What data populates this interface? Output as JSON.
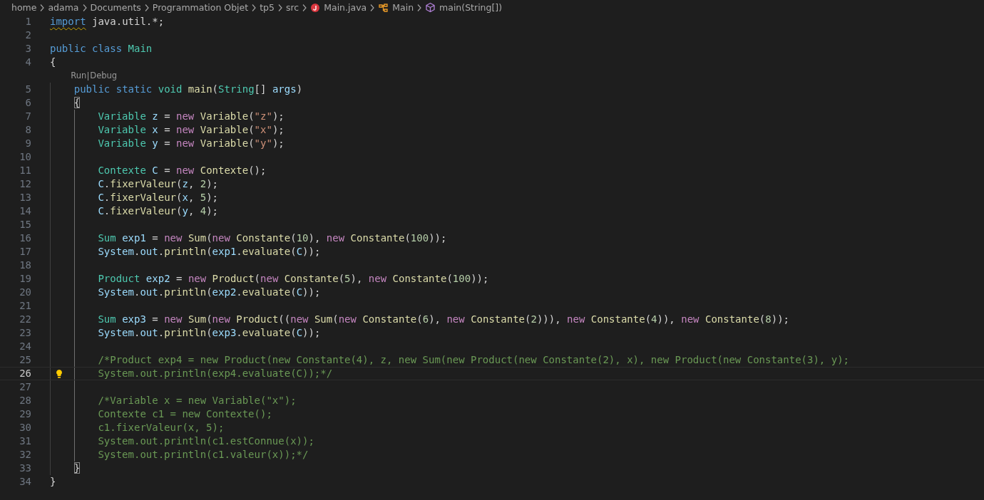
{
  "breadcrumb": [
    {
      "label": "home",
      "kind": "folder"
    },
    {
      "label": "adama",
      "kind": "folder"
    },
    {
      "label": "Documents",
      "kind": "folder"
    },
    {
      "label": "Programmation Objet",
      "kind": "folder"
    },
    {
      "label": "tp5",
      "kind": "folder"
    },
    {
      "label": "src",
      "kind": "folder"
    },
    {
      "label": "Main.java",
      "kind": "java-file"
    },
    {
      "label": "Main",
      "kind": "class"
    },
    {
      "label": "main(String[])",
      "kind": "method"
    }
  ],
  "editor": {
    "lines": [
      {
        "number": "1",
        "tokens": [
          {
            "kind": "kw",
            "text": "import",
            "warning": true
          },
          {
            "kind": "pl",
            "text": " java.util.*;"
          }
        ]
      },
      {
        "number": "2"
      },
      {
        "number": "3",
        "tokens": [
          {
            "kind": "kw",
            "text": "public class"
          },
          {
            "kind": "type",
            "text": " Main"
          }
        ]
      },
      {
        "number": "4",
        "tokens": [
          {
            "kind": "pl",
            "text": "{"
          }
        ],
        "children": [
          {
            "number": "5",
            "codelens": [
              "Run",
              "Debug"
            ],
            "tokens": [
              {
                "kind": "kw",
                "text": "public static"
              },
              {
                "kind": "type",
                "text": " void"
              },
              {
                "kind": "fn",
                "text": " main"
              },
              {
                "kind": "pl",
                "text": "("
              },
              {
                "kind": "type",
                "text": "String"
              },
              {
                "kind": "pl",
                "text": "[] "
              },
              {
                "kind": "var",
                "text": "args"
              },
              {
                "kind": "pl",
                "text": ")"
              }
            ]
          },
          {
            "number": "6",
            "tokens": [
              {
                "kind": "pl",
                "text": "{",
                "matched": true
              }
            ],
            "children": [
              {
                "number": "7",
                "tokens": [
                  {
                    "kind": "type",
                    "text": "Variable"
                  },
                  {
                    "kind": "var",
                    "text": " z"
                  },
                  {
                    "kind": "pl",
                    "text": " = "
                  },
                  {
                    "kind": "ctl",
                    "text": "new"
                  },
                  {
                    "kind": "fn",
                    "text": " Variable"
                  },
                  {
                    "kind": "pl",
                    "text": "("
                  },
                  {
                    "kind": "str",
                    "text": "\"z\""
                  },
                  {
                    "kind": "pl",
                    "text": ");"
                  }
                ]
              },
              {
                "number": "8",
                "tokens": [
                  {
                    "kind": "type",
                    "text": "Variable"
                  },
                  {
                    "kind": "var",
                    "text": " x"
                  },
                  {
                    "kind": "pl",
                    "text": " = "
                  },
                  {
                    "kind": "ctl",
                    "text": "new"
                  },
                  {
                    "kind": "fn",
                    "text": " Variable"
                  },
                  {
                    "kind": "pl",
                    "text": "("
                  },
                  {
                    "kind": "str",
                    "text": "\"x\""
                  },
                  {
                    "kind": "pl",
                    "text": ");"
                  }
                ]
              },
              {
                "number": "9",
                "tokens": [
                  {
                    "kind": "type",
                    "text": "Variable"
                  },
                  {
                    "kind": "var",
                    "text": " y"
                  },
                  {
                    "kind": "pl",
                    "text": " = "
                  },
                  {
                    "kind": "ctl",
                    "text": "new"
                  },
                  {
                    "kind": "fn",
                    "text": " Variable"
                  },
                  {
                    "kind": "pl",
                    "text": "("
                  },
                  {
                    "kind": "str",
                    "text": "\"y\""
                  },
                  {
                    "kind": "pl",
                    "text": ");"
                  }
                ]
              },
              {
                "number": "10"
              },
              {
                "number": "11",
                "tokens": [
                  {
                    "kind": "type",
                    "text": "Contexte"
                  },
                  {
                    "kind": "var",
                    "text": " C"
                  },
                  {
                    "kind": "pl",
                    "text": " = "
                  },
                  {
                    "kind": "ctl",
                    "text": "new"
                  },
                  {
                    "kind": "fn",
                    "text": " Contexte"
                  },
                  {
                    "kind": "pl",
                    "text": "();"
                  }
                ]
              },
              {
                "number": "12",
                "tokens": [
                  {
                    "kind": "var",
                    "text": "C"
                  },
                  {
                    "kind": "pl",
                    "text": "."
                  },
                  {
                    "kind": "fn",
                    "text": "fixerValeur"
                  },
                  {
                    "kind": "pl",
                    "text": "("
                  },
                  {
                    "kind": "var",
                    "text": "z"
                  },
                  {
                    "kind": "pl",
                    "text": ", "
                  },
                  {
                    "kind": "num",
                    "text": "2"
                  },
                  {
                    "kind": "pl",
                    "text": ");"
                  }
                ]
              },
              {
                "number": "13",
                "tokens": [
                  {
                    "kind": "var",
                    "text": "C"
                  },
                  {
                    "kind": "pl",
                    "text": "."
                  },
                  {
                    "kind": "fn",
                    "text": "fixerValeur"
                  },
                  {
                    "kind": "pl",
                    "text": "("
                  },
                  {
                    "kind": "var",
                    "text": "x"
                  },
                  {
                    "kind": "pl",
                    "text": ", "
                  },
                  {
                    "kind": "num",
                    "text": "5"
                  },
                  {
                    "kind": "pl",
                    "text": ");"
                  }
                ]
              },
              {
                "number": "14",
                "tokens": [
                  {
                    "kind": "var",
                    "text": "C"
                  },
                  {
                    "kind": "pl",
                    "text": "."
                  },
                  {
                    "kind": "fn",
                    "text": "fixerValeur"
                  },
                  {
                    "kind": "pl",
                    "text": "("
                  },
                  {
                    "kind": "var",
                    "text": "y"
                  },
                  {
                    "kind": "pl",
                    "text": ", "
                  },
                  {
                    "kind": "num",
                    "text": "4"
                  },
                  {
                    "kind": "pl",
                    "text": ");"
                  }
                ]
              },
              {
                "number": "15"
              },
              {
                "number": "16",
                "tokens": [
                  {
                    "kind": "type",
                    "text": "Sum"
                  },
                  {
                    "kind": "var",
                    "text": " exp1"
                  },
                  {
                    "kind": "pl",
                    "text": " = "
                  },
                  {
                    "kind": "ctl",
                    "text": "new"
                  },
                  {
                    "kind": "fn",
                    "text": " Sum"
                  },
                  {
                    "kind": "pl",
                    "text": "("
                  },
                  {
                    "kind": "ctl",
                    "text": "new"
                  },
                  {
                    "kind": "fn",
                    "text": " Constante"
                  },
                  {
                    "kind": "pl",
                    "text": "("
                  },
                  {
                    "kind": "num",
                    "text": "10"
                  },
                  {
                    "kind": "pl",
                    "text": "), "
                  },
                  {
                    "kind": "ctl",
                    "text": "new"
                  },
                  {
                    "kind": "fn",
                    "text": " Constante"
                  },
                  {
                    "kind": "pl",
                    "text": "("
                  },
                  {
                    "kind": "num",
                    "text": "100"
                  },
                  {
                    "kind": "pl",
                    "text": "));"
                  }
                ]
              },
              {
                "number": "17",
                "tokens": [
                  {
                    "kind": "var",
                    "text": "System"
                  },
                  {
                    "kind": "pl",
                    "text": "."
                  },
                  {
                    "kind": "var",
                    "text": "out"
                  },
                  {
                    "kind": "pl",
                    "text": "."
                  },
                  {
                    "kind": "fn",
                    "text": "println"
                  },
                  {
                    "kind": "pl",
                    "text": "("
                  },
                  {
                    "kind": "var",
                    "text": "exp1"
                  },
                  {
                    "kind": "pl",
                    "text": "."
                  },
                  {
                    "kind": "fn",
                    "text": "evaluate"
                  },
                  {
                    "kind": "pl",
                    "text": "("
                  },
                  {
                    "kind": "var",
                    "text": "C"
                  },
                  {
                    "kind": "pl",
                    "text": "));"
                  }
                ]
              },
              {
                "number": "18"
              },
              {
                "number": "19",
                "tokens": [
                  {
                    "kind": "type",
                    "text": "Product"
                  },
                  {
                    "kind": "var",
                    "text": " exp2"
                  },
                  {
                    "kind": "pl",
                    "text": " = "
                  },
                  {
                    "kind": "ctl",
                    "text": "new"
                  },
                  {
                    "kind": "fn",
                    "text": " Product"
                  },
                  {
                    "kind": "pl",
                    "text": "("
                  },
                  {
                    "kind": "ctl",
                    "text": "new"
                  },
                  {
                    "kind": "fn",
                    "text": " Constante"
                  },
                  {
                    "kind": "pl",
                    "text": "("
                  },
                  {
                    "kind": "num",
                    "text": "5"
                  },
                  {
                    "kind": "pl",
                    "text": "), "
                  },
                  {
                    "kind": "ctl",
                    "text": "new"
                  },
                  {
                    "kind": "fn",
                    "text": " Constante"
                  },
                  {
                    "kind": "pl",
                    "text": "("
                  },
                  {
                    "kind": "num",
                    "text": "100"
                  },
                  {
                    "kind": "pl",
                    "text": "));"
                  }
                ]
              },
              {
                "number": "20",
                "tokens": [
                  {
                    "kind": "var",
                    "text": "System"
                  },
                  {
                    "kind": "pl",
                    "text": "."
                  },
                  {
                    "kind": "var",
                    "text": "out"
                  },
                  {
                    "kind": "pl",
                    "text": "."
                  },
                  {
                    "kind": "fn",
                    "text": "println"
                  },
                  {
                    "kind": "pl",
                    "text": "("
                  },
                  {
                    "kind": "var",
                    "text": "exp2"
                  },
                  {
                    "kind": "pl",
                    "text": "."
                  },
                  {
                    "kind": "fn",
                    "text": "evaluate"
                  },
                  {
                    "kind": "pl",
                    "text": "("
                  },
                  {
                    "kind": "var",
                    "text": "C"
                  },
                  {
                    "kind": "pl",
                    "text": "));"
                  }
                ]
              },
              {
                "number": "21"
              },
              {
                "number": "22",
                "tokens": [
                  {
                    "kind": "type",
                    "text": "Sum"
                  },
                  {
                    "kind": "var",
                    "text": " exp3"
                  },
                  {
                    "kind": "pl",
                    "text": " = "
                  },
                  {
                    "kind": "ctl",
                    "text": "new"
                  },
                  {
                    "kind": "fn",
                    "text": " Sum"
                  },
                  {
                    "kind": "pl",
                    "text": "("
                  },
                  {
                    "kind": "ctl",
                    "text": "new"
                  },
                  {
                    "kind": "fn",
                    "text": " Product"
                  },
                  {
                    "kind": "pl",
                    "text": "(("
                  },
                  {
                    "kind": "ctl",
                    "text": "new"
                  },
                  {
                    "kind": "fn",
                    "text": " Sum"
                  },
                  {
                    "kind": "pl",
                    "text": "("
                  },
                  {
                    "kind": "ctl",
                    "text": "new"
                  },
                  {
                    "kind": "fn",
                    "text": " Constante"
                  },
                  {
                    "kind": "pl",
                    "text": "("
                  },
                  {
                    "kind": "num",
                    "text": "6"
                  },
                  {
                    "kind": "pl",
                    "text": "), "
                  },
                  {
                    "kind": "ctl",
                    "text": "new"
                  },
                  {
                    "kind": "fn",
                    "text": " Constante"
                  },
                  {
                    "kind": "pl",
                    "text": "("
                  },
                  {
                    "kind": "num",
                    "text": "2"
                  },
                  {
                    "kind": "pl",
                    "text": "))), "
                  },
                  {
                    "kind": "ctl",
                    "text": "new"
                  },
                  {
                    "kind": "fn",
                    "text": " Constante"
                  },
                  {
                    "kind": "pl",
                    "text": "("
                  },
                  {
                    "kind": "num",
                    "text": "4"
                  },
                  {
                    "kind": "pl",
                    "text": ")), "
                  },
                  {
                    "kind": "ctl",
                    "text": "new"
                  },
                  {
                    "kind": "fn",
                    "text": " Constante"
                  },
                  {
                    "kind": "pl",
                    "text": "("
                  },
                  {
                    "kind": "num",
                    "text": "8"
                  },
                  {
                    "kind": "pl",
                    "text": "));"
                  }
                ]
              },
              {
                "number": "23",
                "tokens": [
                  {
                    "kind": "var",
                    "text": "System"
                  },
                  {
                    "kind": "pl",
                    "text": "."
                  },
                  {
                    "kind": "var",
                    "text": "out"
                  },
                  {
                    "kind": "pl",
                    "text": "."
                  },
                  {
                    "kind": "fn",
                    "text": "println"
                  },
                  {
                    "kind": "pl",
                    "text": "("
                  },
                  {
                    "kind": "var",
                    "text": "exp3"
                  },
                  {
                    "kind": "pl",
                    "text": "."
                  },
                  {
                    "kind": "fn",
                    "text": "evaluate"
                  },
                  {
                    "kind": "pl",
                    "text": "("
                  },
                  {
                    "kind": "var",
                    "text": "C"
                  },
                  {
                    "kind": "pl",
                    "text": "));"
                  }
                ]
              },
              {
                "number": "24"
              },
              {
                "number": "25",
                "tokens": [
                  {
                    "kind": "cm",
                    "text": "/*Product exp4 = new Product(new Constante(4), z, new Sum(new Product(new Constante(2), x), new Product(new Constante(3), y);"
                  }
                ]
              },
              {
                "number": "26",
                "current": true,
                "lightbulb": true,
                "tokens": [
                  {
                    "kind": "cm",
                    "text": "System.out.println(exp4.evaluate(C));*/"
                  }
                ]
              },
              {
                "number": "27"
              },
              {
                "number": "28",
                "tokens": [
                  {
                    "kind": "cm",
                    "text": "/*Variable x = new Variable(\"x\");"
                  }
                ]
              },
              {
                "number": "29",
                "tokens": [
                  {
                    "kind": "cm",
                    "text": "Contexte c1 = new Contexte();"
                  }
                ]
              },
              {
                "number": "30",
                "tokens": [
                  {
                    "kind": "cm",
                    "text": "c1.fixerValeur(x, 5);"
                  }
                ]
              },
              {
                "number": "31",
                "tokens": [
                  {
                    "kind": "cm",
                    "text": "System.out.println(c1.estConnue(x));"
                  }
                ]
              },
              {
                "number": "32",
                "tokens": [
                  {
                    "kind": "cm",
                    "text": "System.out.println(c1.valeur(x));*/"
                  }
                ]
              }
            ]
          },
          {
            "number": "33",
            "tokens": [
              {
                "kind": "pl",
                "text": "}",
                "matched": true
              }
            ]
          }
        ]
      },
      {
        "number": "34",
        "tokens": [
          {
            "kind": "pl",
            "text": "}"
          }
        ]
      }
    ]
  }
}
